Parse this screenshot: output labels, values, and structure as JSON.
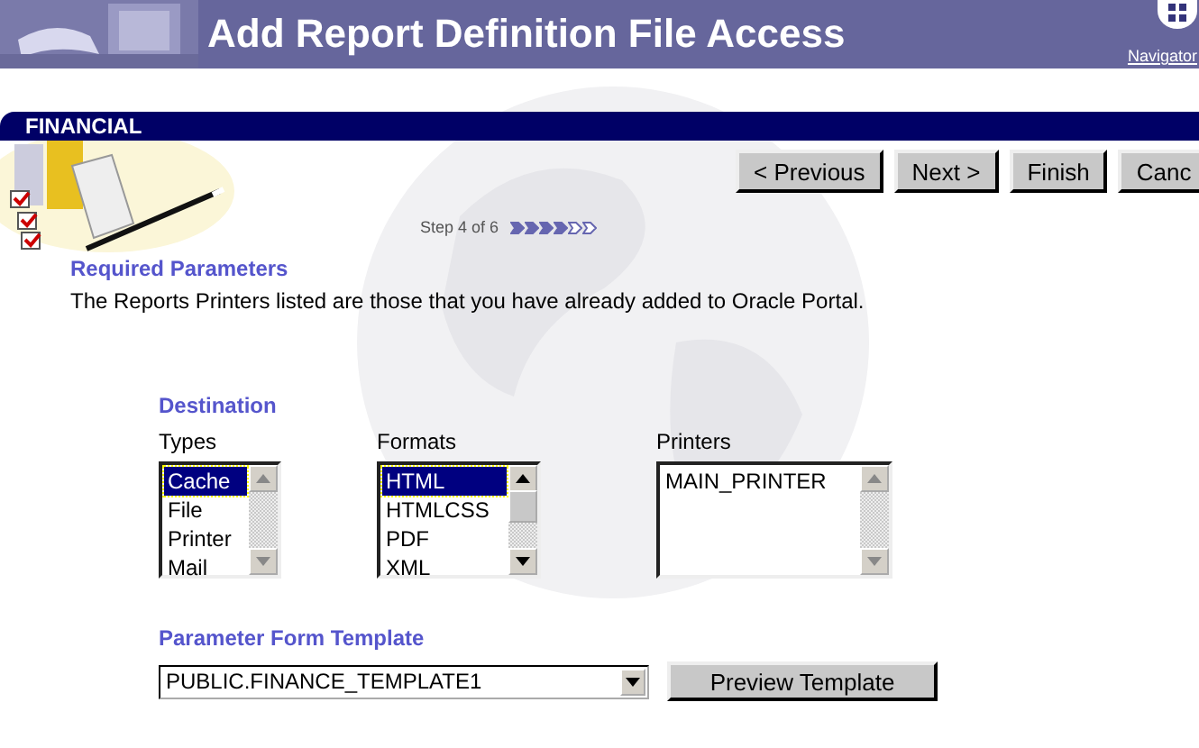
{
  "header": {
    "title": "Add Report Definition File Access",
    "navigator": "Navigator"
  },
  "section": {
    "title": "FINANCIAL"
  },
  "buttons": [
    "< Previous",
    "Next >",
    "Finish",
    "Canc"
  ],
  "step": {
    "text": "Step 4 of 6",
    "steps": [
      {
        "done": true
      },
      {
        "done": true
      },
      {
        "done": true
      },
      {
        "done": true
      },
      {
        "done": false
      },
      {
        "done": false
      }
    ]
  },
  "required": {
    "heading": "Required Parameters",
    "text": "The Reports Printers listed are those that you have already added to Oracle Portal."
  },
  "destination": {
    "heading": "Destination",
    "lists": [
      {
        "label": "Types",
        "items": [
          {
            "text": "Cache",
            "selected": true
          },
          {
            "text": "File",
            "selected": false
          },
          {
            "text": "Printer",
            "selected": false
          },
          {
            "text": "Mail",
            "selected": false
          }
        ]
      },
      {
        "label": "Formats",
        "items": [
          {
            "text": "HTML",
            "selected": true
          },
          {
            "text": "HTMLCSS",
            "selected": false
          },
          {
            "text": "PDF",
            "selected": false
          },
          {
            "text": "XML",
            "selected": false
          }
        ]
      },
      {
        "label": "Printers",
        "items": [
          {
            "text": "MAIN_PRINTER",
            "selected": false
          }
        ]
      }
    ]
  },
  "template": {
    "heading": "Parameter Form Template",
    "value": "PUBLIC.FINANCE_TEMPLATE1",
    "button": "Preview Template"
  }
}
